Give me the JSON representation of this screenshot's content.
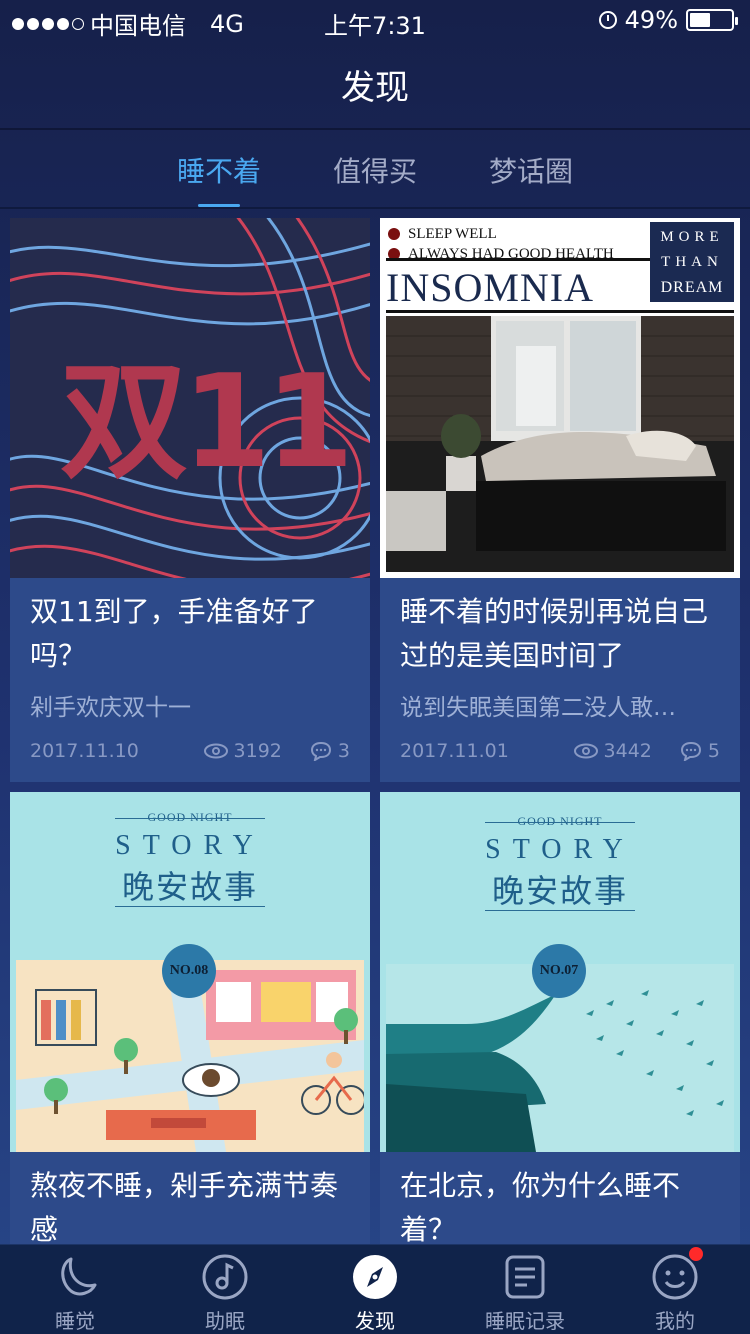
{
  "status_bar": {
    "carrier": "中国电信",
    "network": "4G",
    "time": "上午7:31",
    "battery": "49%"
  },
  "navbar": {
    "title": "发现"
  },
  "tabs": [
    {
      "label": "睡不着",
      "active": true
    },
    {
      "label": "值得买",
      "active": false
    },
    {
      "label": "梦话圈",
      "active": false
    }
  ],
  "cards": [
    {
      "image_text": "双11",
      "title": "双11到了，手准备好了吗？",
      "subtitle": "剁手欢庆双十一",
      "date": "2017.11.10",
      "views": "3192",
      "comments": "3"
    },
    {
      "image_lines": [
        "SLEEP WELL",
        "ALWAYS HAD GOOD HEALTH",
        "INSOMNIA",
        "MORE",
        "THAN",
        "DREAM"
      ],
      "title": "睡不着的时候别再说自己过的是美国时间了",
      "subtitle": "说到失眠美国第二没人敢…",
      "date": "2017.11.01",
      "views": "3442",
      "comments": "5"
    },
    {
      "image_lines": [
        "GOOD NIGHT",
        "STORY",
        "晚安故事",
        "NO.08"
      ],
      "title": "熬夜不睡，剁手充满节奏感"
    },
    {
      "image_lines": [
        "GOOD NIGHT",
        "STORY",
        "晚安故事",
        "NO.07"
      ],
      "title": "在北京，你为什么睡不着？"
    }
  ],
  "tabbar": [
    {
      "label": "睡觉",
      "icon": "moon-icon"
    },
    {
      "label": "助眠",
      "icon": "music-note-icon"
    },
    {
      "label": "发现",
      "icon": "compass-icon",
      "active": true
    },
    {
      "label": "睡眠记录",
      "icon": "notes-icon"
    },
    {
      "label": "我的",
      "icon": "smiley-icon",
      "badge": true
    }
  ],
  "colors": {
    "accent": "#4aa8f0",
    "card_bg": "#2d4a8a",
    "tabbar_bg": "#10234a",
    "badge": "#ff2a2a"
  }
}
